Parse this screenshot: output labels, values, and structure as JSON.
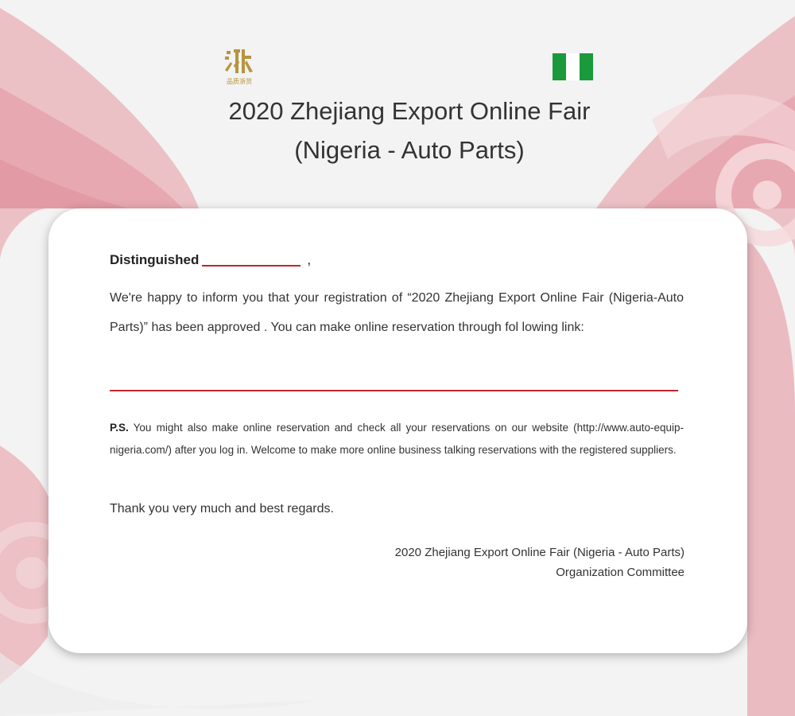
{
  "header": {
    "logo_text": "浙",
    "logo_subtext": "品质浙货",
    "title_line1": "2020 Zhejiang Export  Online Fair",
    "title_line2": "(Nigeria - Auto Parts)"
  },
  "flag": {
    "colors": [
      "#1a9a3b",
      "#ffffff",
      "#1a9a3b"
    ]
  },
  "colors": {
    "accent": "#c0262d",
    "logo_gold": "#b8943f",
    "background": "#f3f3f3"
  },
  "letter": {
    "greeting": "Distinguished",
    "greeting_comma": ",",
    "intro": "We're happy to inform you that your registration of “2020 Zhejiang Export Online Fair (Nigeria-Auto Parts)” has been approved . You can make online reservation through fol lowing link:",
    "ps_label": "P.S.",
    "ps_text": " You might also make online reservation and check all your reservations on our website (http://www.auto-equip-nigeria.com/) after you log in. Welcome to make more online business talking reservations with the registered suppliers.",
    "thanks": "Thank you very much and best regards.",
    "signature_line1": "2020 Zhejiang Export Online Fair (Nigeria - Auto Parts)",
    "signature_line2": "Organization Committee"
  }
}
